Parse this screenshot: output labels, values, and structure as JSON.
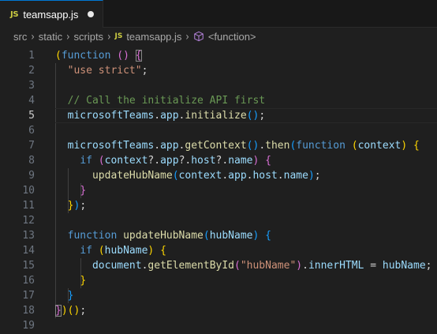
{
  "tab": {
    "language_badge": "JS",
    "title": "teamsapp.js",
    "status": "unsaved"
  },
  "breadcrumb": {
    "items": [
      "src",
      "static",
      "scripts",
      "teamsapp.js",
      "<function>"
    ],
    "file_badge": "JS",
    "symbol_icon": "cube-icon"
  },
  "editor": {
    "active_line": 5,
    "lines": [
      {
        "n": "1",
        "tokens": [
          {
            "t": "(",
            "c": "br1"
          },
          {
            "t": "function",
            "c": "kw"
          },
          {
            "t": " ",
            "c": "pl"
          },
          {
            "t": "()",
            "c": "br2"
          },
          {
            "t": " ",
            "c": "pl"
          },
          {
            "t": "{",
            "c": "br2 match"
          }
        ]
      },
      {
        "n": "2",
        "tokens": [
          {
            "t": "  ",
            "c": "pl"
          },
          {
            "t": "\"use strict\"",
            "c": "str"
          },
          {
            "t": ";",
            "c": "pl"
          }
        ]
      },
      {
        "n": "3",
        "tokens": []
      },
      {
        "n": "4",
        "tokens": [
          {
            "t": "  ",
            "c": "pl"
          },
          {
            "t": "// Call the initialize API first",
            "c": "cm"
          }
        ]
      },
      {
        "n": "5",
        "tokens": [
          {
            "t": "  ",
            "c": "pl"
          },
          {
            "t": "microsoftTeams",
            "c": "var"
          },
          {
            "t": ".",
            "c": "pl"
          },
          {
            "t": "app",
            "c": "var"
          },
          {
            "t": ".",
            "c": "pl"
          },
          {
            "t": "initialize",
            "c": "fn"
          },
          {
            "t": "()",
            "c": "br3"
          },
          {
            "t": ";",
            "c": "pl"
          }
        ]
      },
      {
        "n": "6",
        "tokens": []
      },
      {
        "n": "7",
        "tokens": [
          {
            "t": "  ",
            "c": "pl"
          },
          {
            "t": "microsoftTeams",
            "c": "var"
          },
          {
            "t": ".",
            "c": "pl"
          },
          {
            "t": "app",
            "c": "var"
          },
          {
            "t": ".",
            "c": "pl"
          },
          {
            "t": "getContext",
            "c": "fn"
          },
          {
            "t": "()",
            "c": "br3"
          },
          {
            "t": ".",
            "c": "pl"
          },
          {
            "t": "then",
            "c": "fn"
          },
          {
            "t": "(",
            "c": "br3"
          },
          {
            "t": "function",
            "c": "kw"
          },
          {
            "t": " ",
            "c": "pl"
          },
          {
            "t": "(",
            "c": "br1"
          },
          {
            "t": "context",
            "c": "var"
          },
          {
            "t": ")",
            "c": "br1"
          },
          {
            "t": " ",
            "c": "pl"
          },
          {
            "t": "{",
            "c": "br1"
          }
        ]
      },
      {
        "n": "8",
        "tokens": [
          {
            "t": "    ",
            "c": "pl"
          },
          {
            "t": "if",
            "c": "kw"
          },
          {
            "t": " ",
            "c": "pl"
          },
          {
            "t": "(",
            "c": "br2"
          },
          {
            "t": "context",
            "c": "var"
          },
          {
            "t": "?.",
            "c": "pl"
          },
          {
            "t": "app",
            "c": "var"
          },
          {
            "t": "?.",
            "c": "pl"
          },
          {
            "t": "host",
            "c": "var"
          },
          {
            "t": "?.",
            "c": "pl"
          },
          {
            "t": "name",
            "c": "var"
          },
          {
            "t": ")",
            "c": "br2"
          },
          {
            "t": " ",
            "c": "pl"
          },
          {
            "t": "{",
            "c": "br2"
          }
        ]
      },
      {
        "n": "9",
        "tokens": [
          {
            "t": "      ",
            "c": "pl"
          },
          {
            "t": "updateHubName",
            "c": "fn"
          },
          {
            "t": "(",
            "c": "br3"
          },
          {
            "t": "context",
            "c": "var"
          },
          {
            "t": ".",
            "c": "pl"
          },
          {
            "t": "app",
            "c": "var"
          },
          {
            "t": ".",
            "c": "pl"
          },
          {
            "t": "host",
            "c": "var"
          },
          {
            "t": ".",
            "c": "pl"
          },
          {
            "t": "name",
            "c": "var"
          },
          {
            "t": ")",
            "c": "br3"
          },
          {
            "t": ";",
            "c": "pl"
          }
        ]
      },
      {
        "n": "10",
        "tokens": [
          {
            "t": "    ",
            "c": "pl"
          },
          {
            "t": "}",
            "c": "br2"
          }
        ]
      },
      {
        "n": "11",
        "tokens": [
          {
            "t": "  ",
            "c": "pl"
          },
          {
            "t": "}",
            "c": "br1"
          },
          {
            "t": ")",
            "c": "br3"
          },
          {
            "t": ";",
            "c": "pl"
          }
        ]
      },
      {
        "n": "12",
        "tokens": []
      },
      {
        "n": "13",
        "tokens": [
          {
            "t": "  ",
            "c": "pl"
          },
          {
            "t": "function",
            "c": "kw"
          },
          {
            "t": " ",
            "c": "pl"
          },
          {
            "t": "updateHubName",
            "c": "fn"
          },
          {
            "t": "(",
            "c": "br3"
          },
          {
            "t": "hubName",
            "c": "var"
          },
          {
            "t": ")",
            "c": "br3"
          },
          {
            "t": " ",
            "c": "pl"
          },
          {
            "t": "{",
            "c": "br3"
          }
        ]
      },
      {
        "n": "14",
        "tokens": [
          {
            "t": "    ",
            "c": "pl"
          },
          {
            "t": "if",
            "c": "kw"
          },
          {
            "t": " ",
            "c": "pl"
          },
          {
            "t": "(",
            "c": "br1"
          },
          {
            "t": "hubName",
            "c": "var"
          },
          {
            "t": ")",
            "c": "br1"
          },
          {
            "t": " ",
            "c": "pl"
          },
          {
            "t": "{",
            "c": "br1"
          }
        ]
      },
      {
        "n": "15",
        "tokens": [
          {
            "t": "      ",
            "c": "pl"
          },
          {
            "t": "document",
            "c": "var"
          },
          {
            "t": ".",
            "c": "pl"
          },
          {
            "t": "getElementById",
            "c": "fn"
          },
          {
            "t": "(",
            "c": "br2"
          },
          {
            "t": "\"hubName\"",
            "c": "str"
          },
          {
            "t": ")",
            "c": "br2"
          },
          {
            "t": ".",
            "c": "pl"
          },
          {
            "t": "innerHTML",
            "c": "var"
          },
          {
            "t": " = ",
            "c": "pl"
          },
          {
            "t": "hubName",
            "c": "var"
          },
          {
            "t": ";",
            "c": "pl"
          }
        ]
      },
      {
        "n": "16",
        "tokens": [
          {
            "t": "    ",
            "c": "pl"
          },
          {
            "t": "}",
            "c": "br1"
          }
        ]
      },
      {
        "n": "17",
        "tokens": [
          {
            "t": "  ",
            "c": "pl"
          },
          {
            "t": "}",
            "c": "br3"
          }
        ]
      },
      {
        "n": "18",
        "tokens": [
          {
            "t": "}",
            "c": "br2 match"
          },
          {
            "t": ")",
            "c": "br1"
          },
          {
            "t": "()",
            "c": "br1"
          },
          {
            "t": ";",
            "c": "pl"
          }
        ]
      },
      {
        "n": "19",
        "tokens": []
      }
    ]
  },
  "colors": {
    "background": "#1f1f1f",
    "keyword": "#569cd6",
    "string": "#ce9178",
    "comment": "#6a9955",
    "variable": "#9cdcfe",
    "function": "#dcdcaa",
    "bracket_1": "#ffd700",
    "bracket_2": "#da70d6",
    "bracket_3": "#179fff"
  }
}
